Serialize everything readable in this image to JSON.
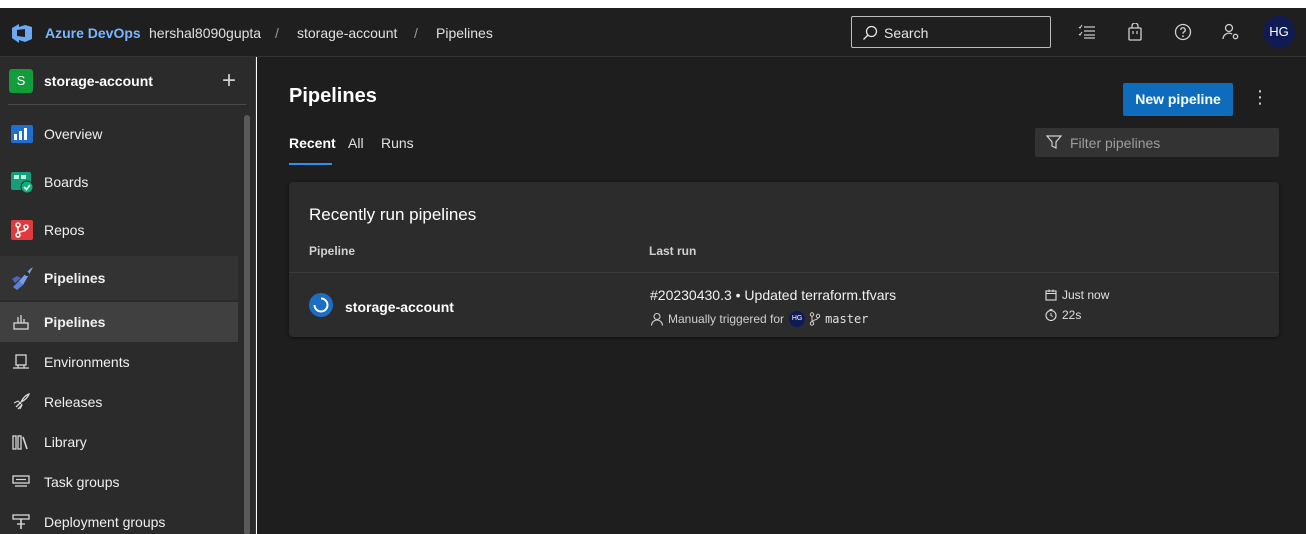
{
  "topbar": {
    "brand": "Azure DevOps",
    "breadcrumbs": [
      "hershal8090gupta",
      "storage-account",
      "Pipelines"
    ],
    "separator": "/",
    "search_label": "Search",
    "avatar_initials": "HG",
    "icons": [
      "settings-list-icon",
      "shopping-bag-icon",
      "help-icon",
      "user-settings-icon"
    ]
  },
  "sidebar": {
    "project_initial": "S",
    "project_name": "storage-account",
    "add_label": "+",
    "items": [
      {
        "label": "Overview",
        "icon": "overview-icon"
      },
      {
        "label": "Boards",
        "icon": "boards-icon"
      },
      {
        "label": "Repos",
        "icon": "repos-icon"
      },
      {
        "label": "Pipelines",
        "icon": "pipelines-icon"
      }
    ],
    "sub_items": [
      {
        "label": "Pipelines",
        "icon": "pipelines-sub-icon"
      },
      {
        "label": "Environments",
        "icon": "environments-icon"
      },
      {
        "label": "Releases",
        "icon": "releases-icon"
      },
      {
        "label": "Library",
        "icon": "library-icon"
      },
      {
        "label": "Task groups",
        "icon": "task-groups-icon"
      },
      {
        "label": "Deployment groups",
        "icon": "deployment-groups-icon"
      }
    ]
  },
  "main": {
    "title": "Pipelines",
    "new_button": "New pipeline",
    "more": "⋮",
    "tabs": [
      "Recent",
      "All",
      "Runs"
    ],
    "filter_placeholder": "Filter pipelines",
    "card": {
      "title": "Recently run pipelines",
      "columns": [
        "Pipeline",
        "Last run"
      ],
      "rows": [
        {
          "name": "storage-account",
          "run_title": "#20230430.3 • Updated terraform.tfvars",
          "trigger_text": "Manually triggered for",
          "trigger_avatar": "HG",
          "branch": "master",
          "when": "Just now",
          "duration": "22s"
        }
      ]
    }
  },
  "colors": {
    "accent": "#0f6cbd",
    "brand_text": "#7ab6ff",
    "project_badge": "#139d3a"
  }
}
